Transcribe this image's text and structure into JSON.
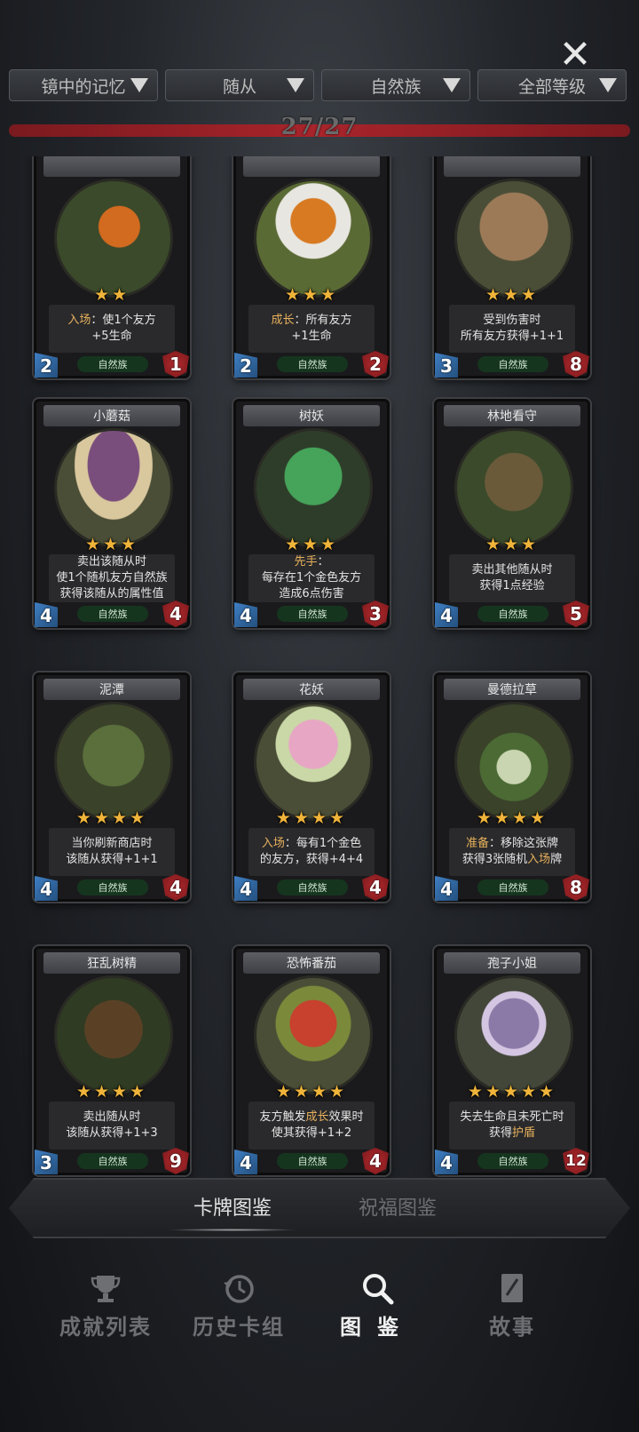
{
  "header": {
    "close_glyph": "✕",
    "filters": [
      {
        "label": "镜中的记忆"
      },
      {
        "label": "随从"
      },
      {
        "label": "自然族"
      },
      {
        "label": "全部等级"
      }
    ],
    "progress": {
      "text": "27/27",
      "current": 27,
      "total": 27
    }
  },
  "cards": [
    {
      "name": "",
      "stars": "★★",
      "desc_html": "<span class='hl'>入场</span>：使1个友方<br>+5生命",
      "race": "自然族",
      "cost": "2",
      "hp": "1",
      "portrait": "pumpkin-reaper"
    },
    {
      "name": "",
      "stars": "★★★",
      "desc_html": "<span class='hl'>成长</span>：所有友方<br>+1生命",
      "race": "自然族",
      "cost": "2",
      "hp": "2",
      "portrait": "pumpkin-cat"
    },
    {
      "name": "",
      "stars": "★★★",
      "desc_html": "受到伤害时<br>所有友方获得+1+1",
      "race": "自然族",
      "cost": "3",
      "hp": "8",
      "portrait": "wood-golem"
    },
    {
      "name": "小蘑菇",
      "stars": "★★★",
      "desc_html": "卖出该随从时<br>使1个随机友方自然族<br>获得该随从的属性值",
      "race": "自然族",
      "cost": "4",
      "hp": "4",
      "portrait": "mushroom"
    },
    {
      "name": "树妖",
      "stars": "★★★",
      "desc_html": "<span class='hl'>先手</span>：<br>每存在1个金色友方<br>造成6点伤害",
      "race": "自然族",
      "cost": "4",
      "hp": "3",
      "portrait": "dryad"
    },
    {
      "name": "林地看守",
      "stars": "★★★",
      "desc_html": "卖出其他随从时<br>获得1点经验",
      "race": "自然族",
      "cost": "4",
      "hp": "5",
      "portrait": "forest-warden"
    },
    {
      "name": "泥潭",
      "stars": "★★★★",
      "desc_html": "当你刷新商店时<br>该随从获得+1+1",
      "race": "自然族",
      "cost": "4",
      "hp": "4",
      "portrait": "swamp"
    },
    {
      "name": "花妖",
      "stars": "★★★★",
      "desc_html": "<span class='hl'>入场</span>：每有1个金色<br>的友方，获得+4+4",
      "race": "自然族",
      "cost": "4",
      "hp": "4",
      "portrait": "flower-fairy"
    },
    {
      "name": "曼德拉草",
      "stars": "★★★★",
      "desc_html": "<span class='hl'>准备</span>：移除这张牌<br>获得3张随机<span class='hl'>入场</span>牌",
      "race": "自然族",
      "cost": "4",
      "hp": "8",
      "portrait": "mandrake"
    },
    {
      "name": "狂乱树精",
      "stars": "★★★★",
      "desc_html": "卖出随从时<br>该随从获得+1+3",
      "race": "自然族",
      "cost": "3",
      "hp": "9",
      "portrait": "frenzied-treant"
    },
    {
      "name": "恐怖番茄",
      "stars": "★★★★",
      "desc_html": "友方触发<span class='hl'>成长</span>效果时<br>使其获得+1+2",
      "race": "自然族",
      "cost": "4",
      "hp": "4",
      "portrait": "terror-tomato"
    },
    {
      "name": "孢子小姐",
      "stars": "★★★★★",
      "desc_html": "失去生命且未死亡时<br>获得<span class='hl'>护盾</span>",
      "race": "自然族",
      "cost": "4",
      "hp": "12",
      "portrait": "spore-lady"
    }
  ],
  "sub_tabs": [
    {
      "label": "卡牌图鉴",
      "active": true
    },
    {
      "label": "祝福图鉴",
      "active": false
    }
  ],
  "nav": [
    {
      "label": "成就列表",
      "icon": "trophy-icon",
      "active": false
    },
    {
      "label": "历史卡组",
      "icon": "history-icon",
      "active": false
    },
    {
      "label": "图鉴",
      "icon": "magnifier-icon",
      "active": true
    },
    {
      "label": "故事",
      "icon": "book-icon",
      "active": false
    }
  ],
  "colors": {
    "accent_red": "#a8242b",
    "highlight_gold": "#e7b15c",
    "star_gold": "#f0b43a",
    "cost_blue": "#3f7fc4",
    "hp_red": "#b12a2e",
    "race_green": "#16351f"
  }
}
